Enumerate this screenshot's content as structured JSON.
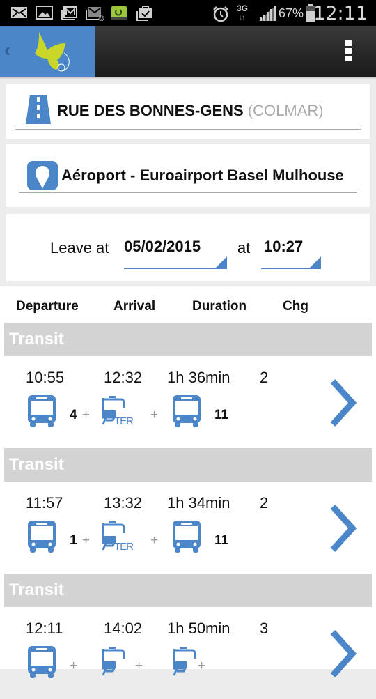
{
  "status_bar": {
    "notification_icons": [
      "mail-icon",
      "image-icon",
      "gmail-icon",
      "email-icon",
      "sync-icon",
      "clipboard-check-icon"
    ],
    "alarm_icon": "alarm-icon",
    "network": "3G",
    "signal_icon": "signal-icon",
    "battery_percent": "67%",
    "battery_icon": "battery-icon",
    "time": "12:11"
  },
  "app_bar": {
    "back_icon": "back-chevron-icon",
    "logo": "butterfly-logo",
    "menu_icon": "overflow-menu-icon"
  },
  "origin": {
    "icon": "road-icon",
    "name": "RUE DES BONNES-GENS",
    "city": " (COLMAR)"
  },
  "destination": {
    "icon": "map-pin-icon",
    "name": "Aéroport - Euroairport Basel Mulhouse"
  },
  "schedule": {
    "leave_label": "Leave at",
    "date": "05/02/2015",
    "at_label": "at",
    "time": "10:27"
  },
  "columns": [
    "Departure",
    "Arrival",
    "Duration",
    "Chg"
  ],
  "accent_color": "#4a86c8",
  "results": [
    {
      "section": "Transit",
      "departure": "10:55",
      "arrival": "12:32",
      "duration": "1h 36min",
      "changes": "2",
      "legs": [
        {
          "mode": "bus",
          "line": "4"
        },
        {
          "mode": "ter",
          "line": "TER"
        },
        {
          "mode": "bus",
          "line": "11"
        }
      ]
    },
    {
      "section": "Transit",
      "departure": "11:57",
      "arrival": "13:32",
      "duration": "1h 34min",
      "changes": "2",
      "legs": [
        {
          "mode": "bus",
          "line": "1"
        },
        {
          "mode": "ter",
          "line": "TER"
        },
        {
          "mode": "bus",
          "line": "11"
        }
      ]
    },
    {
      "section": "Transit",
      "departure": "12:11",
      "arrival": "14:02",
      "duration": "1h 50min",
      "changes": "3",
      "legs": [
        {
          "mode": "bus",
          "line": ""
        },
        {
          "mode": "ter",
          "line": ""
        },
        {
          "mode": "ter",
          "line": ""
        }
      ]
    }
  ],
  "plus_sign": "+"
}
